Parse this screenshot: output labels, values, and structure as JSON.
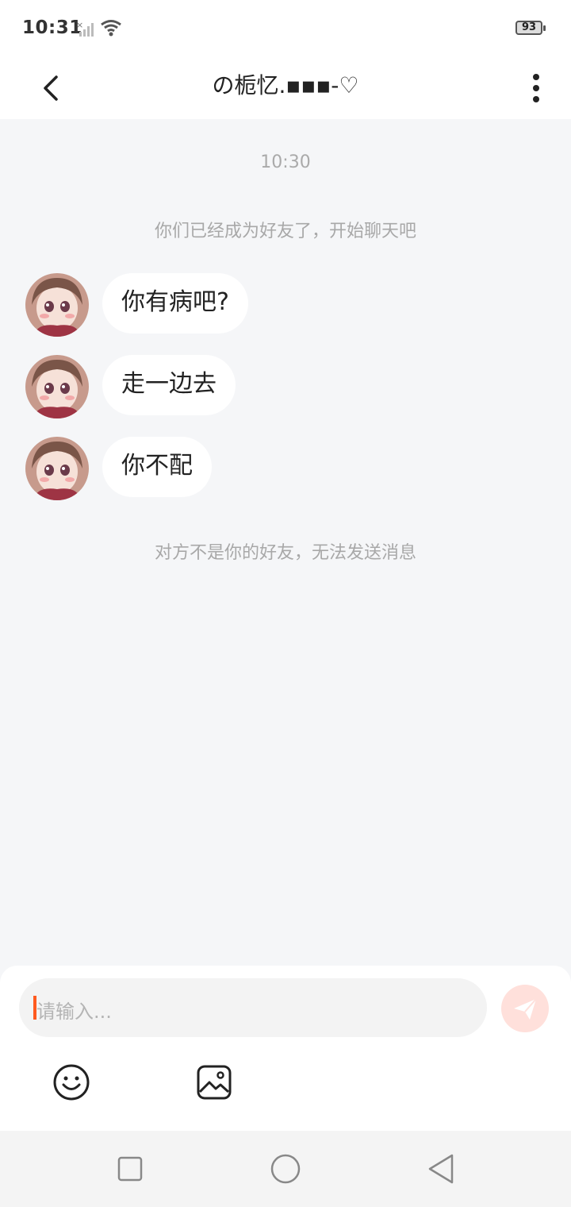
{
  "status_bar": {
    "time": "10:31",
    "battery": "93"
  },
  "header": {
    "title": "の栀忆.▪▪▪-♡"
  },
  "chat": {
    "timestamp": "10:30",
    "system_top": "你们已经成为好友了，开始聊天吧",
    "messages": [
      {
        "text": "你有病吧?"
      },
      {
        "text": "走一边去"
      },
      {
        "text": "你不配"
      }
    ],
    "system_bottom": "对方不是你的好友，无法发送消息"
  },
  "input": {
    "placeholder": "请输入..."
  },
  "colors": {
    "accent": "#ff5a1f",
    "send_button": "#ffe0db",
    "chat_bg": "#f5f6f8"
  },
  "icons": [
    "back-icon",
    "more-icon",
    "send-icon",
    "emoji-icon",
    "image-icon",
    "recent-apps-icon",
    "home-icon",
    "nav-back-icon"
  ]
}
